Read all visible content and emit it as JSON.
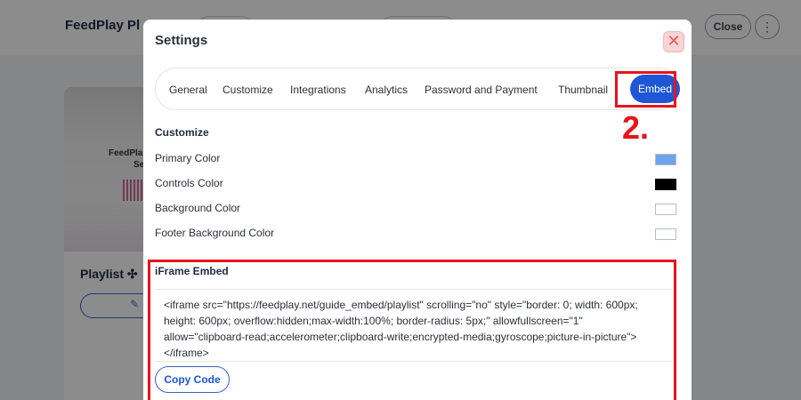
{
  "background": {
    "title": "FeedPlay Pl",
    "close_label": "Close",
    "more_icon": "⋮",
    "card_name_line1": "FeedPla",
    "card_name_line2": "Se",
    "playlist_label": "Playlist ✣",
    "edit_icon": "✎"
  },
  "modal": {
    "title": "Settings",
    "close_icon": "✕",
    "tabs": [
      {
        "label": "General"
      },
      {
        "label": "Customize"
      },
      {
        "label": "Integrations"
      },
      {
        "label": "Analytics"
      },
      {
        "label": "Password and Payment"
      },
      {
        "label": "Thumbnail"
      },
      {
        "label": "Embed",
        "active": true
      }
    ],
    "customize": {
      "title": "Customize",
      "rows": [
        {
          "label": "Primary Color",
          "color": "#6fa3ea"
        },
        {
          "label": "Controls Color",
          "color": "#000000"
        },
        {
          "label": "Background Color",
          "color": "#ffffff"
        },
        {
          "label": "Footer Background Color",
          "color": "#ffffff"
        }
      ]
    },
    "embed": {
      "title": "iFrame Embed",
      "code": "<iframe src=\"https://feedplay.net/guide_embed/playlist\" scrolling=\"no\" style=\"border: 0; width: 600px; height: 600px; overflow:hidden;max-width:100%; border-radius: 5px;\" allowfullscreen=\"1\" allow=\"clipboard-read;accelerometer;clipboard-write;encrypted-media;gyroscope;picture-in-picture\"></iframe>",
      "copy_label": "Copy Code"
    }
  },
  "annotation": {
    "step_number": "2.",
    "color": "#e8141b"
  }
}
